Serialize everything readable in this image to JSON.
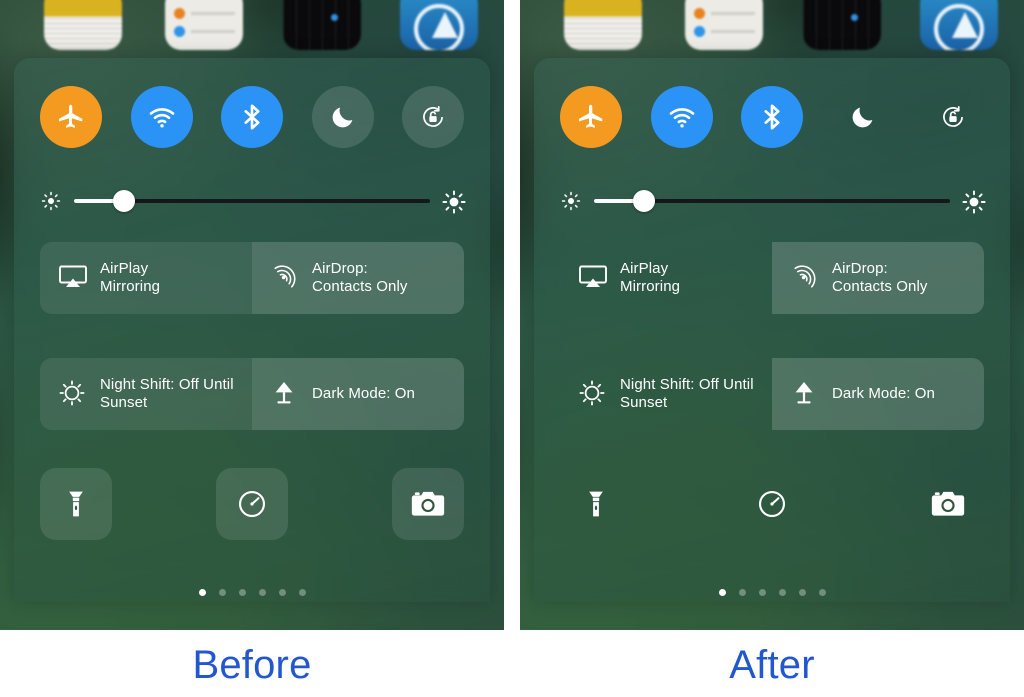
{
  "page": {
    "accent_blue": "#2357cf",
    "background": "#ffffff"
  },
  "panels": [
    {
      "id": "before",
      "caption": "Before",
      "dock_icons": [
        {
          "name": "notes-app-icon",
          "label": "Notes"
        },
        {
          "name": "reminders-app-icon",
          "label": "Reminders"
        },
        {
          "name": "stocks-app-icon",
          "label": "Stocks"
        },
        {
          "name": "app-store-app-icon",
          "label": "App Store"
        }
      ],
      "toggles": [
        {
          "name": "airplane-mode-toggle",
          "icon": "airplane-icon",
          "label": "Airplane Mode",
          "state": "on",
          "style": "airplane",
          "color": "#f59a20"
        },
        {
          "name": "wifi-toggle",
          "icon": "wifi-icon",
          "label": "Wi-Fi",
          "state": "on",
          "style": "wifi",
          "color": "#2b93f5"
        },
        {
          "name": "bluetooth-toggle",
          "icon": "bluetooth-icon",
          "label": "Bluetooth",
          "state": "on",
          "style": "bt",
          "color": "#2b93f5"
        },
        {
          "name": "do-not-disturb-toggle",
          "icon": "moon-icon",
          "label": "Do Not Disturb",
          "state": "off",
          "style": "plate",
          "color": "transparent"
        },
        {
          "name": "rotation-lock-toggle",
          "icon": "rotation-lock-icon",
          "label": "Portrait Orientation Lock",
          "state": "off",
          "style": "plate",
          "color": "transparent"
        }
      ],
      "brightness": {
        "label": "Brightness",
        "value_percent": 14,
        "low_icon": "brightness-low-icon",
        "high_icon": "brightness-high-icon"
      },
      "tiles_row_1": [
        {
          "name": "airplay-mirroring-tile",
          "icon": "airplay-icon",
          "text": "AirPlay\nMirroring",
          "plate": "plate-dim"
        },
        {
          "name": "airdrop-tile",
          "icon": "airdrop-icon",
          "text": "AirDrop:\nContacts Only",
          "plate": "plate-lit"
        }
      ],
      "tiles_row_2": [
        {
          "name": "night-shift-tile",
          "icon": "night-shift-icon",
          "text": "Night Shift: Off Until\nSunset",
          "plate": "plate-dim"
        },
        {
          "name": "dark-mode-tile",
          "icon": "lamp-icon",
          "text": "Dark Mode: On",
          "plate": "plate-lit"
        }
      ],
      "shortcuts": [
        {
          "name": "flashlight-shortcut",
          "icon": "flashlight-icon",
          "label": "Flashlight",
          "plate": "plate"
        },
        {
          "name": "timer-shortcut",
          "icon": "timer-icon",
          "label": "Timer",
          "plate": "plate"
        },
        {
          "name": "camera-shortcut",
          "icon": "camera-icon",
          "label": "Camera",
          "plate": "plate"
        }
      ],
      "page_dots": {
        "count": 6,
        "active_index": 0
      }
    },
    {
      "id": "after",
      "caption": "After",
      "dock_icons": [
        {
          "name": "notes-app-icon",
          "label": "Notes"
        },
        {
          "name": "reminders-app-icon",
          "label": "Reminders"
        },
        {
          "name": "stocks-app-icon",
          "label": "Stocks"
        },
        {
          "name": "app-store-app-icon",
          "label": "App Store"
        }
      ],
      "toggles": [
        {
          "name": "airplane-mode-toggle",
          "icon": "airplane-icon",
          "label": "Airplane Mode",
          "state": "on",
          "style": "airplane",
          "color": "#f59a20"
        },
        {
          "name": "wifi-toggle",
          "icon": "wifi-icon",
          "label": "Wi-Fi",
          "state": "on",
          "style": "wifi",
          "color": "#2b93f5"
        },
        {
          "name": "bluetooth-toggle",
          "icon": "bluetooth-icon",
          "label": "Bluetooth",
          "state": "on",
          "style": "bt",
          "color": "#2b93f5"
        },
        {
          "name": "do-not-disturb-toggle",
          "icon": "moon-icon",
          "label": "Do Not Disturb",
          "state": "off",
          "style": "noplate",
          "color": "transparent"
        },
        {
          "name": "rotation-lock-toggle",
          "icon": "rotation-lock-icon",
          "label": "Portrait Orientation Lock",
          "state": "off",
          "style": "noplate",
          "color": "transparent"
        }
      ],
      "brightness": {
        "label": "Brightness",
        "value_percent": 14,
        "low_icon": "brightness-low-icon",
        "high_icon": "brightness-high-icon"
      },
      "tiles_row_1": [
        {
          "name": "airplay-mirroring-tile",
          "icon": "airplay-icon",
          "text": "AirPlay\nMirroring",
          "plate": "plate-none"
        },
        {
          "name": "airdrop-tile",
          "icon": "airdrop-icon",
          "text": "AirDrop:\nContacts Only",
          "plate": "plate-lit"
        }
      ],
      "tiles_row_2": [
        {
          "name": "night-shift-tile",
          "icon": "night-shift-icon",
          "text": "Night Shift: Off Until\nSunset",
          "plate": "plate-none"
        },
        {
          "name": "dark-mode-tile",
          "icon": "lamp-icon",
          "text": "Dark Mode: On",
          "plate": "plate-lit"
        }
      ],
      "shortcuts": [
        {
          "name": "flashlight-shortcut",
          "icon": "flashlight-icon",
          "label": "Flashlight",
          "plate": "noplate"
        },
        {
          "name": "timer-shortcut",
          "icon": "timer-icon",
          "label": "Timer",
          "plate": "noplate"
        },
        {
          "name": "camera-shortcut",
          "icon": "camera-icon",
          "label": "Camera",
          "plate": "noplate"
        }
      ],
      "page_dots": {
        "count": 6,
        "active_index": 0
      }
    }
  ]
}
